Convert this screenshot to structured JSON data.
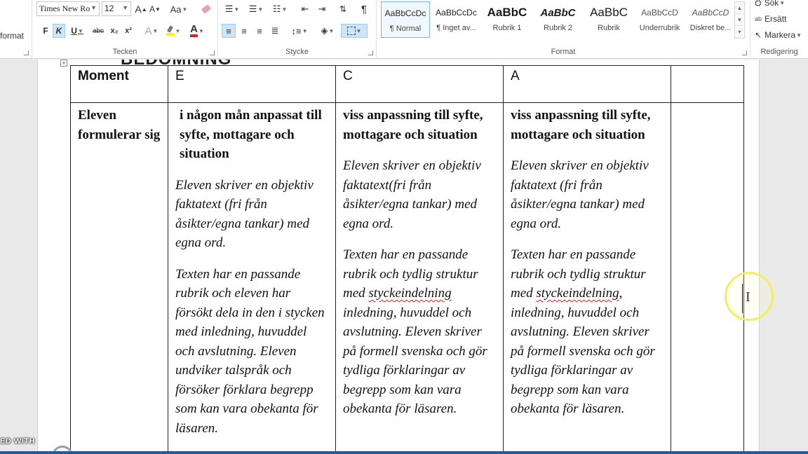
{
  "ribbon": {
    "clipboard": {
      "format_label": "format"
    },
    "font": {
      "group_label": "Tecken",
      "font_name": "Times New Ro",
      "font_size": "12",
      "grow_label": "A",
      "shrink_label": "A",
      "case_label": "Aa",
      "bold_label": "F",
      "italic_label": "K",
      "underline_label": "U",
      "strike_label": "abc",
      "sub_label": "x₂",
      "super_label": "x²",
      "effects_label": "A",
      "fontcolor_label": "A"
    },
    "paragraph": {
      "group_label": "Stycke"
    },
    "styles": {
      "group_label": "Format",
      "tiles": [
        {
          "preview": "AaBbCcDc",
          "name": "¶ Normal"
        },
        {
          "preview": "AaBbCcDc",
          "name": "¶ Inget av..."
        },
        {
          "preview": "AaBbC",
          "name": "Rubrik 1"
        },
        {
          "preview": "AaBbC",
          "name": "Rubrik 2"
        },
        {
          "preview": "AaBbC",
          "name": "Rubrik"
        },
        {
          "preview": "AaBbCcD",
          "name": "Underrubrik"
        },
        {
          "preview": "AaBbCcD",
          "name": "Diskret be..."
        }
      ]
    },
    "editing": {
      "group_label": "Redigering",
      "find_label": "Sök",
      "replace_label": "Ersätt",
      "select_label": "Markera"
    }
  },
  "document": {
    "ghost_heading": "BEDÖMNING",
    "table": {
      "headers": [
        "Moment",
        "E",
        "C",
        "A",
        ""
      ],
      "row": {
        "moment": "Eleven formulerar sig",
        "e": {
          "heading": "i någon mån anpassat till syfte, mottagare och situation",
          "p1": "Eleven skriver en objektiv faktatext (fri från åsikter/egna tankar) med egna ord.",
          "p2": "Texten har en passande rubrik och eleven har försökt dela in den i stycken med inledning, huvuddel och avslutning. Eleven undviker talspråk och försöker förklara begrepp som kan vara obekanta för läsaren."
        },
        "c": {
          "heading": "viss anpassning till syfte, mottagare och situation",
          "p1": "Eleven skriver en objektiv faktatext(fri från åsikter/egna tankar) med egna ord.",
          "p2_pre": "Texten har en passande rubrik och tydlig struktur med ",
          "p2_squiggle": "styckeindelning",
          "p2_post": " inledning, huvuddel och avslutning. Eleven skriver på formell svenska och gör tydliga förklaringar av begrepp som kan vara obekanta för läsaren."
        },
        "a": {
          "heading": "viss anpassning till syfte, mottagare och situation",
          "p1": "Eleven skriver en objektiv faktatext (fri från åsikter/egna tankar) med egna ord.",
          "p2_pre": "Texten har en passande rubrik och tydlig struktur med ",
          "p2_squiggle": "styckeindelning",
          "p2_post": ", inledning, huvuddel och avslutning. Eleven skriver på formell svenska och gör tydliga förklaringar av begrepp som kan vara obekanta för läsaren."
        },
        "extra": ""
      }
    }
  },
  "overlay": {
    "watermark": "ED WITH",
    "ibeam": "I"
  },
  "colors": {
    "accent": "#2b579a",
    "cursor_highlight": "#f3ee5c",
    "spell_error": "#d42020"
  }
}
